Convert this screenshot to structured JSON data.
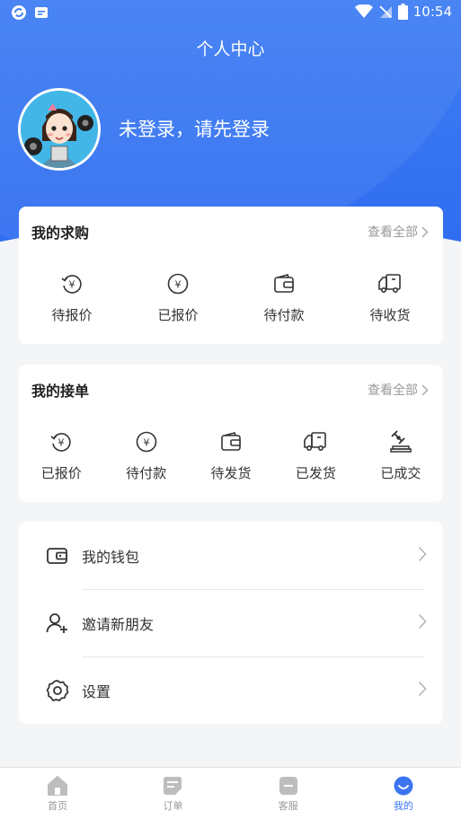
{
  "status_bar": {
    "time": "10:54"
  },
  "header": {
    "title": "个人中心",
    "login_prompt": "未登录，请先登录"
  },
  "purchase_card": {
    "title": "我的求购",
    "view_all": "查看全部",
    "items": [
      {
        "label": "待报价",
        "icon": "yuan-refresh-icon"
      },
      {
        "label": "已报价",
        "icon": "yuan-circle-icon"
      },
      {
        "label": "待付款",
        "icon": "wallet-icon"
      },
      {
        "label": "待收货",
        "icon": "truck-icon"
      }
    ]
  },
  "orders_card": {
    "title": "我的接单",
    "view_all": "查看全部",
    "items": [
      {
        "label": "已报价",
        "icon": "yuan-refresh-icon"
      },
      {
        "label": "待付款",
        "icon": "yuan-circle-icon"
      },
      {
        "label": "待发货",
        "icon": "wallet-icon"
      },
      {
        "label": "已发货",
        "icon": "truck-icon"
      },
      {
        "label": "已成交",
        "icon": "gavel-icon"
      }
    ]
  },
  "menu": [
    {
      "label": "我的钱包",
      "icon": "wallet-icon"
    },
    {
      "label": "邀请新朋友",
      "icon": "add-user-icon"
    },
    {
      "label": "设置",
      "icon": "gear-icon"
    }
  ],
  "tabbar": {
    "active_color": "#3b74f0",
    "tabs": [
      {
        "label": "首页",
        "icon": "home-icon"
      },
      {
        "label": "订单",
        "icon": "orders-icon"
      },
      {
        "label": "客服",
        "icon": "service-icon"
      },
      {
        "label": "我的",
        "icon": "profile-icon"
      }
    ]
  },
  "colors": {
    "brand": "#3f7ef4",
    "background": "#f4f5f7"
  }
}
